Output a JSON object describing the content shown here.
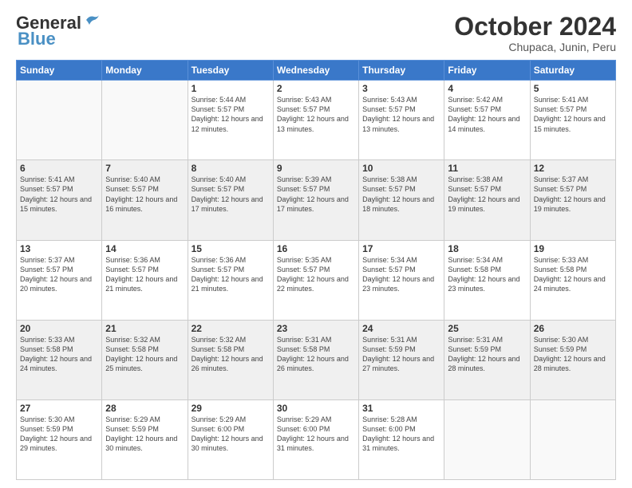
{
  "header": {
    "logo_general": "General",
    "logo_blue": "Blue",
    "month": "October 2024",
    "location": "Chupaca, Junin, Peru"
  },
  "weekdays": [
    "Sunday",
    "Monday",
    "Tuesday",
    "Wednesday",
    "Thursday",
    "Friday",
    "Saturday"
  ],
  "weeks": [
    [
      {
        "day": "",
        "info": ""
      },
      {
        "day": "",
        "info": ""
      },
      {
        "day": "1",
        "info": "Sunrise: 5:44 AM\nSunset: 5:57 PM\nDaylight: 12 hours\nand 12 minutes."
      },
      {
        "day": "2",
        "info": "Sunrise: 5:43 AM\nSunset: 5:57 PM\nDaylight: 12 hours\nand 13 minutes."
      },
      {
        "day": "3",
        "info": "Sunrise: 5:43 AM\nSunset: 5:57 PM\nDaylight: 12 hours\nand 13 minutes."
      },
      {
        "day": "4",
        "info": "Sunrise: 5:42 AM\nSunset: 5:57 PM\nDaylight: 12 hours\nand 14 minutes."
      },
      {
        "day": "5",
        "info": "Sunrise: 5:41 AM\nSunset: 5:57 PM\nDaylight: 12 hours\nand 15 minutes."
      }
    ],
    [
      {
        "day": "6",
        "info": "Sunrise: 5:41 AM\nSunset: 5:57 PM\nDaylight: 12 hours\nand 15 minutes."
      },
      {
        "day": "7",
        "info": "Sunrise: 5:40 AM\nSunset: 5:57 PM\nDaylight: 12 hours\nand 16 minutes."
      },
      {
        "day": "8",
        "info": "Sunrise: 5:40 AM\nSunset: 5:57 PM\nDaylight: 12 hours\nand 17 minutes."
      },
      {
        "day": "9",
        "info": "Sunrise: 5:39 AM\nSunset: 5:57 PM\nDaylight: 12 hours\nand 17 minutes."
      },
      {
        "day": "10",
        "info": "Sunrise: 5:38 AM\nSunset: 5:57 PM\nDaylight: 12 hours\nand 18 minutes."
      },
      {
        "day": "11",
        "info": "Sunrise: 5:38 AM\nSunset: 5:57 PM\nDaylight: 12 hours\nand 19 minutes."
      },
      {
        "day": "12",
        "info": "Sunrise: 5:37 AM\nSunset: 5:57 PM\nDaylight: 12 hours\nand 19 minutes."
      }
    ],
    [
      {
        "day": "13",
        "info": "Sunrise: 5:37 AM\nSunset: 5:57 PM\nDaylight: 12 hours\nand 20 minutes."
      },
      {
        "day": "14",
        "info": "Sunrise: 5:36 AM\nSunset: 5:57 PM\nDaylight: 12 hours\nand 21 minutes."
      },
      {
        "day": "15",
        "info": "Sunrise: 5:36 AM\nSunset: 5:57 PM\nDaylight: 12 hours\nand 21 minutes."
      },
      {
        "day": "16",
        "info": "Sunrise: 5:35 AM\nSunset: 5:57 PM\nDaylight: 12 hours\nand 22 minutes."
      },
      {
        "day": "17",
        "info": "Sunrise: 5:34 AM\nSunset: 5:57 PM\nDaylight: 12 hours\nand 23 minutes."
      },
      {
        "day": "18",
        "info": "Sunrise: 5:34 AM\nSunset: 5:58 PM\nDaylight: 12 hours\nand 23 minutes."
      },
      {
        "day": "19",
        "info": "Sunrise: 5:33 AM\nSunset: 5:58 PM\nDaylight: 12 hours\nand 24 minutes."
      }
    ],
    [
      {
        "day": "20",
        "info": "Sunrise: 5:33 AM\nSunset: 5:58 PM\nDaylight: 12 hours\nand 24 minutes."
      },
      {
        "day": "21",
        "info": "Sunrise: 5:32 AM\nSunset: 5:58 PM\nDaylight: 12 hours\nand 25 minutes."
      },
      {
        "day": "22",
        "info": "Sunrise: 5:32 AM\nSunset: 5:58 PM\nDaylight: 12 hours\nand 26 minutes."
      },
      {
        "day": "23",
        "info": "Sunrise: 5:31 AM\nSunset: 5:58 PM\nDaylight: 12 hours\nand 26 minutes."
      },
      {
        "day": "24",
        "info": "Sunrise: 5:31 AM\nSunset: 5:59 PM\nDaylight: 12 hours\nand 27 minutes."
      },
      {
        "day": "25",
        "info": "Sunrise: 5:31 AM\nSunset: 5:59 PM\nDaylight: 12 hours\nand 28 minutes."
      },
      {
        "day": "26",
        "info": "Sunrise: 5:30 AM\nSunset: 5:59 PM\nDaylight: 12 hours\nand 28 minutes."
      }
    ],
    [
      {
        "day": "27",
        "info": "Sunrise: 5:30 AM\nSunset: 5:59 PM\nDaylight: 12 hours\nand 29 minutes."
      },
      {
        "day": "28",
        "info": "Sunrise: 5:29 AM\nSunset: 5:59 PM\nDaylight: 12 hours\nand 30 minutes."
      },
      {
        "day": "29",
        "info": "Sunrise: 5:29 AM\nSunset: 6:00 PM\nDaylight: 12 hours\nand 30 minutes."
      },
      {
        "day": "30",
        "info": "Sunrise: 5:29 AM\nSunset: 6:00 PM\nDaylight: 12 hours\nand 31 minutes."
      },
      {
        "day": "31",
        "info": "Sunrise: 5:28 AM\nSunset: 6:00 PM\nDaylight: 12 hours\nand 31 minutes."
      },
      {
        "day": "",
        "info": ""
      },
      {
        "day": "",
        "info": ""
      }
    ]
  ]
}
